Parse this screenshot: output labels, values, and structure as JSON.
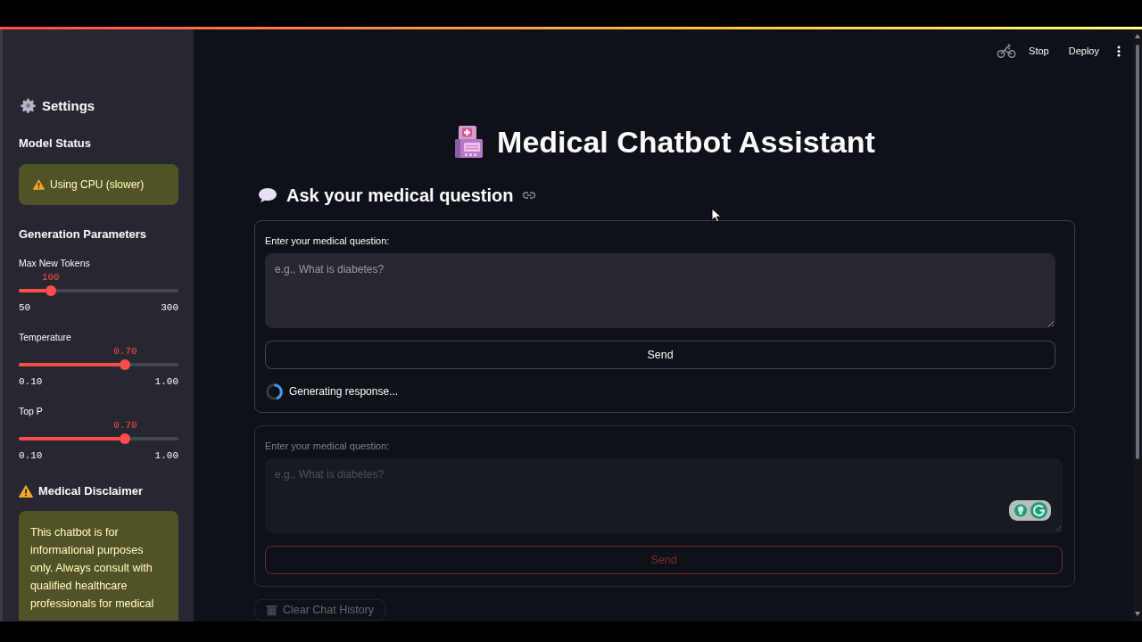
{
  "toolbar": {
    "buttons": [
      "Stop",
      "Deploy"
    ]
  },
  "sidebar": {
    "title": "Settings",
    "model_status": {
      "heading": "Model Status",
      "alert": "Using CPU (slower)"
    },
    "generation_parameters": {
      "heading": "Generation Parameters",
      "sliders": [
        {
          "label": "Max New Tokens",
          "value": "100",
          "min": "50",
          "max": "300",
          "level": 0.2
        },
        {
          "label": "Temperature",
          "value": "0.70",
          "min": "0.10",
          "max": "1.00",
          "level": 0.667
        },
        {
          "label": "Top P",
          "value": "0.70",
          "min": "0.10",
          "max": "1.00",
          "level": 0.667
        }
      ]
    },
    "disclaimer": {
      "heading": "Medical Disclaimer",
      "text": "This chatbot is for informational purposes only. Always consult with qualified healthcare professionals for medical"
    }
  },
  "main": {
    "title": "Medical Chatbot Assistant",
    "subheader": "Ask your medical question",
    "forms": [
      {
        "label": "Enter your medical question:",
        "placeholder": "e.g., What is diabetes?",
        "button": {
          "label": "Send",
          "highlighted": false
        },
        "status": "Generating response...",
        "disabled": false,
        "overlay_badge": false
      },
      {
        "label": "Enter your medical question:",
        "placeholder": "e.g., What is diabetes?",
        "button": {
          "label": "Send",
          "highlighted": true
        },
        "disabled": true,
        "overlay_badge": true
      }
    ],
    "clear_button": {
      "label": "Clear Chat History",
      "disabled": true
    }
  }
}
